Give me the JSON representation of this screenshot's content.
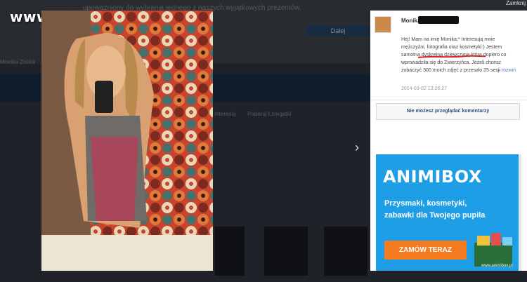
{
  "site": {
    "logo": "www.wiocha.pl",
    "close_label": "Zamknij"
  },
  "background": {
    "notice": "upoważniony do wybrania jednego z naszych wyjątkowych prezentów.",
    "next_button": "Dalej",
    "sidebar_label": "Monika Zośka",
    "tags": [
      "Interesuj",
      "Podaruj Łzregatki"
    ]
  },
  "comment": {
    "author": "Monika",
    "text": "Hej! Mam na imię Monika;* Interesują mnie mężczyźni, fotografia oraz kosmetyki:) Jestem samotną dyskretną dziewczyną która dopiero co wprowadziła się do Zwierzyńca. Jeżeli chcesz zobaczyć 300 moich zdjęć z przeszło 25 sesji",
    "expand_link": "rozwiń",
    "date": "2014-03-02 13:26:27"
  },
  "notice": {
    "no_comments": "Nie możesz przeglądać komentarzy"
  },
  "ad": {
    "brand": "ANIMIBOX",
    "line1": "Przysmaki, kosmetyki,",
    "line2": "zabawki dla Twojego pupila",
    "cta": "ZAMÓW TERAZ",
    "footer": "www.animibox.pl"
  },
  "colors": {
    "ad_blue": "#1d9ee6",
    "cta_orange": "#f47b20",
    "link_blue": "#4a7fbd",
    "underline_red": "#e0242a"
  }
}
